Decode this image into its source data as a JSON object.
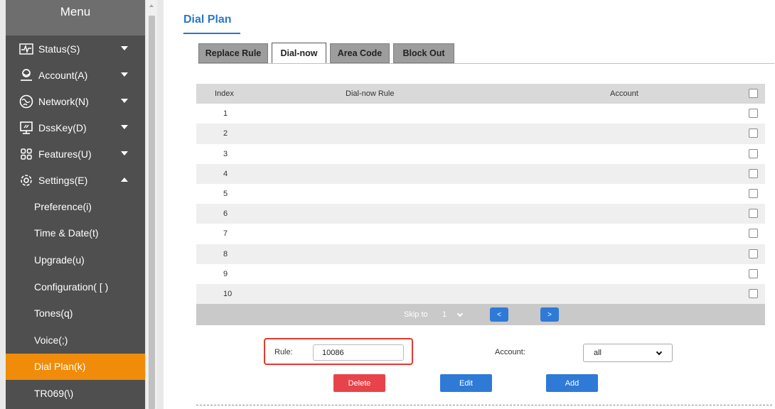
{
  "sidebar": {
    "title": "Menu",
    "groups": [
      {
        "label": "Status(S)",
        "icon": "pulse-icon",
        "expanded": false
      },
      {
        "label": "Account(A)",
        "icon": "account-icon",
        "expanded": false
      },
      {
        "label": "Network(N)",
        "icon": "network-icon",
        "expanded": false
      },
      {
        "label": "DssKey(D)",
        "icon": "dsskey-icon",
        "expanded": false
      },
      {
        "label": "Features(U)",
        "icon": "features-icon",
        "expanded": false
      },
      {
        "label": "Settings(E)",
        "icon": "settings-icon",
        "expanded": true
      }
    ],
    "sub_items": [
      {
        "label": "Preference(i)"
      },
      {
        "label": "Time & Date(t)"
      },
      {
        "label": "Upgrade(u)"
      },
      {
        "label": "Configuration( [ )"
      },
      {
        "label": "Tones(q)"
      },
      {
        "label": "Voice(;)"
      },
      {
        "label": "Dial Plan(k)",
        "active": true
      },
      {
        "label": "TR069(\\)"
      }
    ],
    "active_color": "#f08c0a"
  },
  "page": {
    "title": "Dial Plan",
    "tabs": [
      {
        "label": "Replace Rule",
        "active": false
      },
      {
        "label": "Dial-now",
        "active": true
      },
      {
        "label": "Area Code",
        "active": false
      },
      {
        "label": "Block Out",
        "active": false
      }
    ]
  },
  "table": {
    "headers": {
      "index": "Index",
      "rule": "Dial-now Rule",
      "account": "Account"
    },
    "rows": [
      {
        "index": "1",
        "rule": "",
        "account": ""
      },
      {
        "index": "2",
        "rule": "",
        "account": ""
      },
      {
        "index": "3",
        "rule": "",
        "account": ""
      },
      {
        "index": "4",
        "rule": "",
        "account": ""
      },
      {
        "index": "5",
        "rule": "",
        "account": ""
      },
      {
        "index": "6",
        "rule": "",
        "account": ""
      },
      {
        "index": "7",
        "rule": "",
        "account": ""
      },
      {
        "index": "8",
        "rule": "",
        "account": ""
      },
      {
        "index": "9",
        "rule": "",
        "account": ""
      },
      {
        "index": "10",
        "rule": "",
        "account": ""
      }
    ],
    "pager": {
      "skip_label": "Skip to",
      "page_value": "1",
      "prev_label": "<",
      "next_label": ">"
    }
  },
  "form": {
    "rule_label": "Rule:",
    "rule_value": "10086",
    "account_label": "Account:",
    "account_value": "all",
    "delete_label": "Delete",
    "edit_label": "Edit",
    "add_label": "Add"
  },
  "colors": {
    "accent_blue": "#2f7ad6",
    "delete_red": "#e8434a",
    "highlight_red": "#e03a32"
  }
}
